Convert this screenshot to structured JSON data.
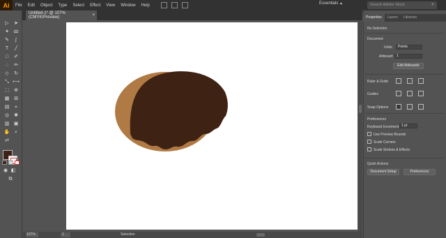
{
  "app": {
    "logo": "Ai"
  },
  "menu": [
    "File",
    "Edit",
    "Object",
    "Type",
    "Select",
    "Effect",
    "View",
    "Window",
    "Help"
  ],
  "workspace": {
    "label": "Essentials",
    "chevron": "▾"
  },
  "search": {
    "placeholder": "Search Adobe Stock"
  },
  "document": {
    "tab_title": "Untitled-1* @ 107% (CMYK/Preview)",
    "close": "×"
  },
  "colors": {
    "fill": "#3f2216",
    "chocolate": "#3e2214",
    "dough": "#b07a45"
  },
  "status": {
    "zoom": "107%",
    "artboard": "1",
    "tool": "Selection"
  },
  "panel": {
    "tabs": [
      "Properties",
      "Layers",
      "Libraries"
    ],
    "selection": "No Selection",
    "document_heading": "Document",
    "units_label": "Units:",
    "units_value": "Points",
    "artboard_label": "Artboard:",
    "artboard_value": "1",
    "edit_artboards": "Edit Artboards",
    "ruler_grids": "Ruler & Grids",
    "guides": "Guides",
    "snap_options": "Snap Options",
    "preferences_heading": "Preferences",
    "keyboard_increment_label": "Keyboard Increment:",
    "keyboard_increment_value": "1 pt",
    "use_preview_bounds": "Use Preview Bounds",
    "scale_corners": "Scale Corners",
    "scale_strokes": "Scale Strokes & Effects",
    "quick_actions": "Quick Actions",
    "document_setup": "Document Setup",
    "preferences_btn": "Preferences"
  }
}
